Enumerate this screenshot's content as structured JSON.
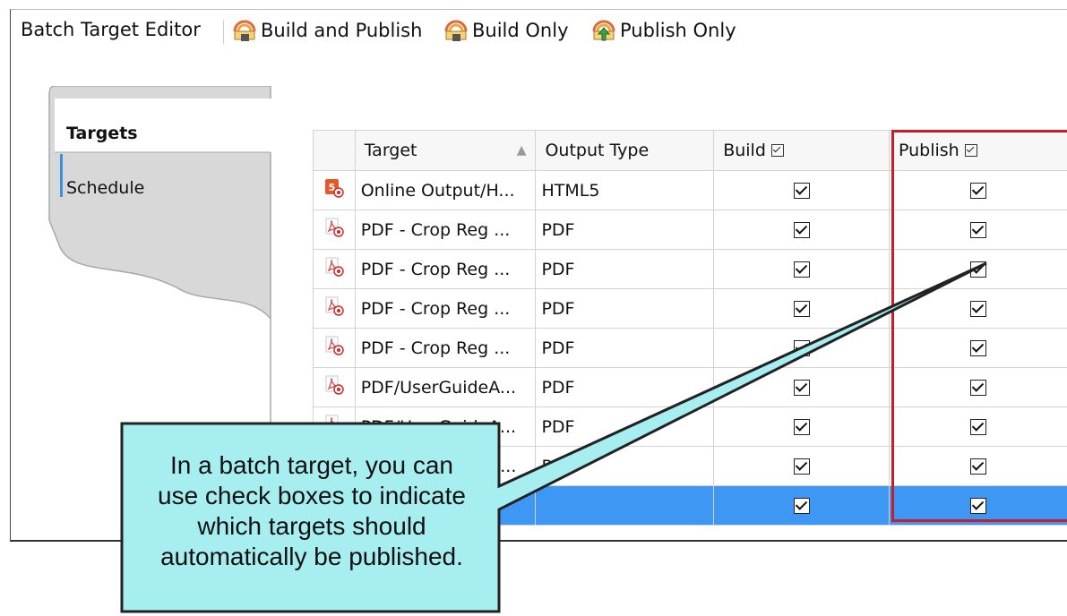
{
  "toolbar": {
    "title": "Batch Target Editor",
    "buttons": [
      {
        "label": "Build and Publish",
        "icon": "build-and-publish-icon"
      },
      {
        "label": "Build Only",
        "icon": "build-only-icon"
      },
      {
        "label": "Publish Only",
        "icon": "publish-only-icon"
      }
    ]
  },
  "tabs": [
    {
      "label": "Targets",
      "selected": true
    },
    {
      "label": "Schedule",
      "selected": false
    }
  ],
  "grid": {
    "columns": [
      "Target",
      "Output Type",
      "Build",
      "Publish"
    ],
    "sort_indicator": "▲",
    "rows": [
      {
        "icon": "html5-target-icon",
        "target": "Online Output/H...",
        "type": "HTML5",
        "build": true,
        "publish": true
      },
      {
        "icon": "pdf-target-icon",
        "target": "PDF - Crop Reg ...",
        "type": "PDF",
        "build": true,
        "publish": true
      },
      {
        "icon": "pdf-target-icon",
        "target": "PDF - Crop Reg ...",
        "type": "PDF",
        "build": true,
        "publish": true
      },
      {
        "icon": "pdf-target-icon",
        "target": "PDF - Crop Reg ...",
        "type": "PDF",
        "build": true,
        "publish": true
      },
      {
        "icon": "pdf-target-icon",
        "target": "PDF - Crop Reg ...",
        "type": "PDF",
        "build": true,
        "publish": true
      },
      {
        "icon": "pdf-target-icon",
        "target": "PDF/UserGuideA...",
        "type": "PDF",
        "build": true,
        "publish": true
      },
      {
        "icon": "pdf-target-icon",
        "target": "PDF/UserGuideA...",
        "type": "PDF",
        "build": true,
        "publish": true
      },
      {
        "icon": "pdf-target-icon",
        "target": "PDF/UserGuideB...",
        "type": "PDF",
        "build": true,
        "publish": true
      },
      {
        "icon": "pdf-target-icon",
        "target": "",
        "type": "",
        "build": true,
        "publish": true,
        "selected": true
      }
    ]
  },
  "callout": {
    "text_lines": [
      "In a batch target, you can",
      "use check boxes to indicate",
      "which targets should",
      "automatically be published."
    ]
  },
  "colors": {
    "highlight_box": "#c41e2a",
    "callout_fill": "#a6eef0",
    "selection": "#3d97f3"
  }
}
